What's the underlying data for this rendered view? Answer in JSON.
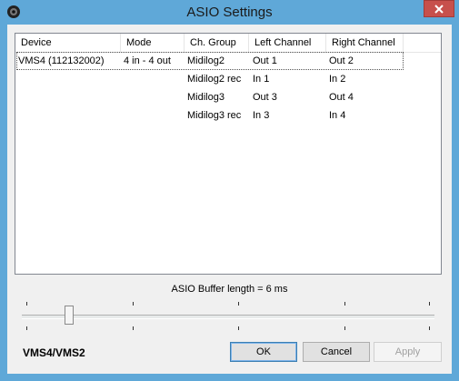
{
  "window": {
    "title": "ASIO Settings"
  },
  "list": {
    "columns": [
      "Device",
      "Mode",
      "Ch. Group",
      "Left Channel",
      "Right Channel"
    ],
    "rows": [
      {
        "device": "VMS4 (112132002)",
        "mode": "4 in - 4 out",
        "group": "Midilog2",
        "left": "Out 1",
        "right": "Out 2",
        "selected": true
      },
      {
        "device": "",
        "mode": "",
        "group": "Midilog2 rec",
        "left": "In 1",
        "right": "In 2"
      },
      {
        "device": "",
        "mode": "",
        "group": "Midilog3",
        "left": "Out 3",
        "right": "Out 4"
      },
      {
        "device": "",
        "mode": "",
        "group": "Midilog3 rec",
        "left": "In 3",
        "right": "In 4"
      }
    ]
  },
  "buffer": {
    "label": "ASIO Buffer length = 6 ms",
    "slider_fraction": 0.115
  },
  "brand": "VMS4/VMS2",
  "buttons": {
    "ok": "OK",
    "cancel": "Cancel",
    "apply": "Apply"
  }
}
